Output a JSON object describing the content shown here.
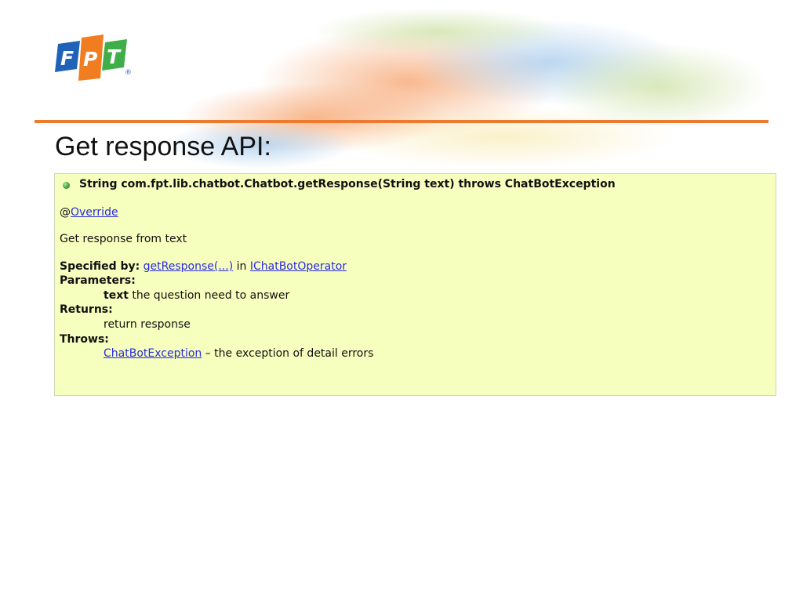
{
  "slide": {
    "title": "Get response API:",
    "logo_text": "FPT",
    "logo_mark": "®",
    "colors": {
      "divider": "#ee7a2f",
      "panel_bg": "#f6ffbd",
      "link": "#2a2ae0",
      "logo_blue": "#1f63b8",
      "logo_orange": "#f07d1f",
      "logo_green": "#3fae49"
    }
  },
  "doc": {
    "signature": "String com.fpt.lib.chatbot.Chatbot.getResponse(String text) throws ChatBotException",
    "annotation_prefix": "@",
    "annotation_link": "Override",
    "description": "Get response from text",
    "specified_by_label": "Specified by:",
    "specified_by_method": "getResponse(...)",
    "specified_by_in": "in",
    "specified_by_interface": "IChatBotOperator",
    "parameters_label": "Parameters:",
    "param_name": "text",
    "param_desc": "the question need to answer",
    "returns_label": "Returns:",
    "returns_desc": "return response",
    "throws_label": "Throws:",
    "throws_link": "ChatBotException",
    "throws_desc": "– the exception of detail errors"
  }
}
